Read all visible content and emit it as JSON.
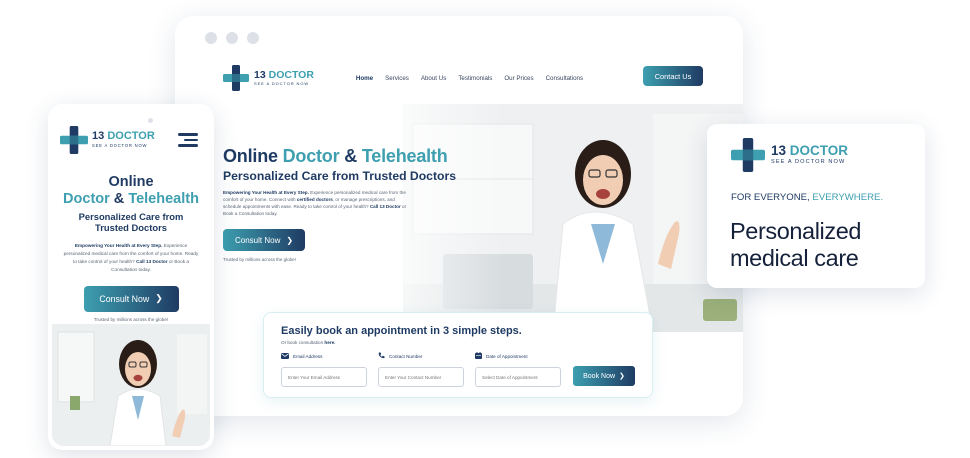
{
  "brand": {
    "number": "13",
    "word": "DOCTOR",
    "tagline": "SEE A DOCTOR NOW",
    "colors": {
      "navy": "#1f3b63",
      "teal": "#3d9fb0"
    }
  },
  "desktop": {
    "nav": [
      "Home",
      "Services",
      "About Us",
      "Testimonials",
      "Our Prices",
      "Consultations"
    ],
    "active_nav": "Home",
    "contact_label": "Contact Us",
    "hero": {
      "title_plain": "Online ",
      "title_accent_1": "Doctor",
      "title_amp": " & ",
      "title_accent_2": "Telehealth",
      "subtitle": "Personalized Care from Trusted Doctors",
      "body_lead": "Empowering Your Health at Every Step.",
      "body_1": " Experience personalized medical care from the comfort of your home. Connect with ",
      "body_bold": "certified doctors",
      "body_2": ", or manage prescriptions, and schedule appointments with ease. Ready to take control of your health? ",
      "body_call": "Call 13 Doctor",
      "body_3": " or Book a Consultation today.",
      "cta": "Consult Now",
      "trust": "Trusted by millions across the globe!"
    },
    "booking": {
      "title": "Easily book an appointment in 3 simple steps.",
      "sub_prefix": "Or book consultation ",
      "sub_link": "here.",
      "fields": [
        {
          "label": "Email Address",
          "placeholder": "Enter Your Email Address",
          "icon": "mail-icon"
        },
        {
          "label": "Contact Number",
          "placeholder": "Enter Your Contact Number",
          "icon": "phone-icon"
        },
        {
          "label": "Date of Appointment",
          "placeholder": "Select Date of Appointment",
          "icon": "calendar-icon"
        }
      ],
      "button": "Book Now"
    }
  },
  "mobile": {
    "title_line_1": "Online",
    "title_accent_1": "Doctor",
    "title_amp": " & ",
    "title_accent_2": "Telehealth",
    "subtitle": "Personalized Care from Trusted Doctors",
    "body_lead": "Empowering Your Health at Every Step.",
    "body_1": " Experience personalized medical care from the comfort of your home. Ready to take control of your health? ",
    "body_call": "Call 13 Doctor",
    "body_2": " or Book a Consultation today.",
    "cta": "Consult Now",
    "trust": "Trusted by millions across the globe!"
  },
  "promo": {
    "tag_plain": "FOR EVERYONE, ",
    "tag_accent": "EVERYWHERE.",
    "headline_1": "Personalized",
    "headline_2": "medical care"
  }
}
